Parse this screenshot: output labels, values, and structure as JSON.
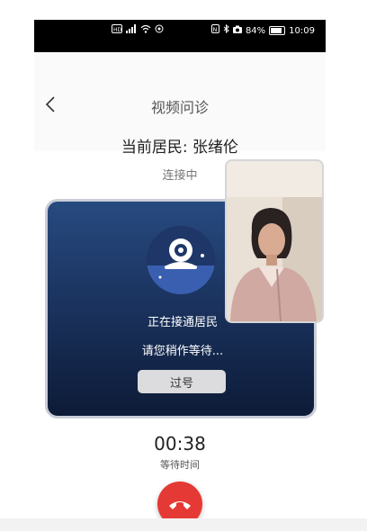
{
  "status_bar": {
    "left_icons": [
      "hd-icon",
      "signal-icon",
      "wifi-icon",
      "location-icon"
    ],
    "battery_text": "84%",
    "battery_level": 0.84,
    "time": "10:09"
  },
  "header": {
    "title": "视频问诊",
    "resident_label": "当前居民: 张绪伦",
    "connection_status": "连接中"
  },
  "call_card": {
    "connecting_text": "正在接通居民",
    "wait_text": "请您稍作等待...",
    "skip_button_label": "过号"
  },
  "timer": {
    "value": "00:38",
    "label": "等待时间"
  },
  "colors": {
    "card_top": "#274a80",
    "card_bottom": "#0d1b37",
    "hangup_red": "#e53935"
  }
}
